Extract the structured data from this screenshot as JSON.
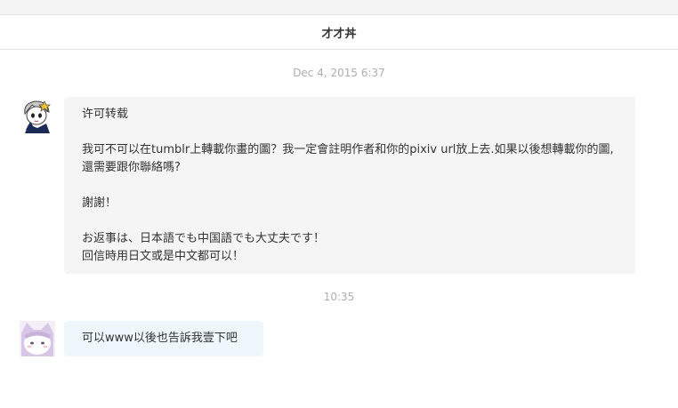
{
  "header": {
    "title": "才才丼"
  },
  "messages": [
    {
      "timestamp": "Dec 4, 2015 6:37",
      "avatar": "anime-girl-avatar-icon",
      "lines": [
        "许可转载",
        "我可不可以在tumblr上轉載你畫的圖？我一定會註明作者和你的pixiv url放上去.如果以後想轉載你的圖,還需要跟你聯絡嗎?",
        "謝謝！",
        "お返事は、日本語でも中国語でも大丈夫です！",
        "回信時用日文或是中文都可以！"
      ]
    },
    {
      "timestamp": "10:35",
      "avatar": "anime-cat-avatar-icon",
      "lines": [
        "可以www以後也告訴我壹下吧"
      ]
    }
  ],
  "colors": {
    "incoming_bubble": "#f5f5f5",
    "outgoing_bubble": "#eef7fb",
    "timestamp": "#adadad"
  }
}
